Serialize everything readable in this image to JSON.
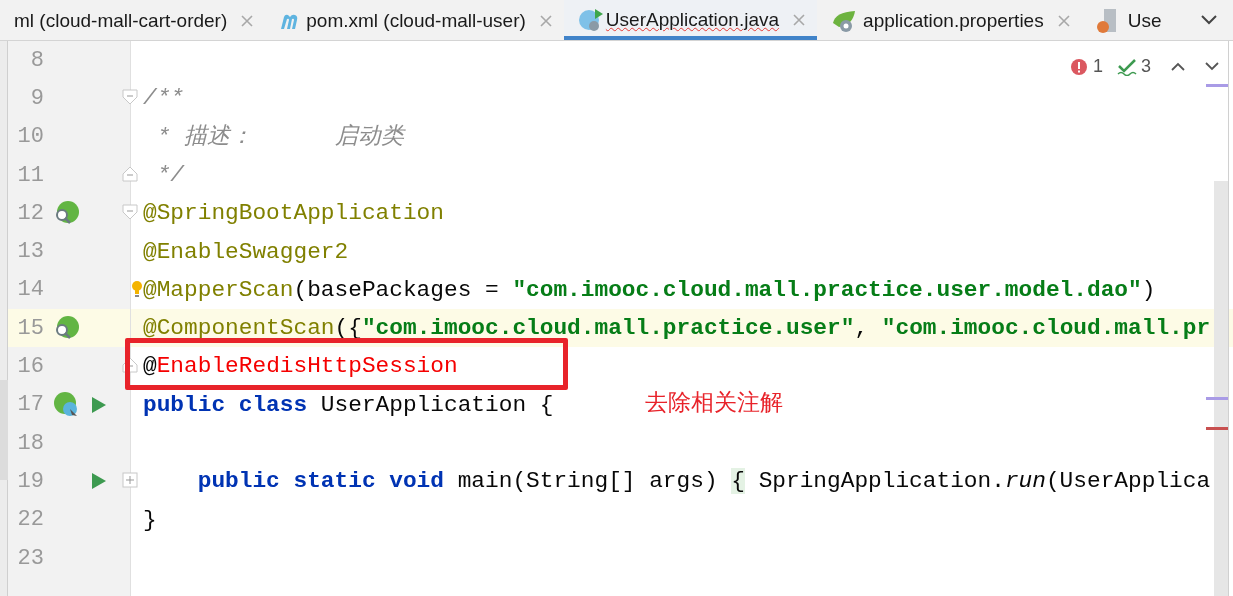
{
  "tabs": [
    {
      "label": "ml (cloud-mall-cart-order)",
      "selected": false
    },
    {
      "label": "pom.xml (cloud-mall-user)",
      "selected": false
    },
    {
      "label": "UserApplication.java",
      "selected": true
    },
    {
      "label": "application.properties",
      "selected": false
    },
    {
      "label": "Use",
      "selected": false
    }
  ],
  "inspections": {
    "errors": "1",
    "warnings": "3"
  },
  "lines": [
    {
      "number": "8"
    },
    {
      "number": "9",
      "fold": {
        "kind": "open"
      },
      "tokens": [
        {
          "text": "/**",
          "kind": "comment"
        }
      ]
    },
    {
      "number": "10",
      "tokens": [
        {
          "text": " * 描述：      启动类",
          "kind": "comment"
        }
      ]
    },
    {
      "number": "11",
      "fold": {
        "kind": "end"
      },
      "tokens": [
        {
          "text": " */",
          "kind": "comment"
        }
      ]
    },
    {
      "number": "12",
      "fold": {
        "kind": "open"
      },
      "markers": [
        {
          "kind": "bean"
        }
      ],
      "tokens": [
        {
          "text": "@SpringBootApplication",
          "kind": "annotation"
        }
      ]
    },
    {
      "number": "13",
      "tokens": [
        {
          "text": "@EnableSwagger2",
          "kind": "annotation"
        }
      ]
    },
    {
      "number": "14",
      "bulb": true,
      "tokens": [
        {
          "text": "@MapperScan",
          "kind": "annotation"
        },
        {
          "text": "(basePackages = ",
          "kind": "plain"
        },
        {
          "text": "\"com.imooc.cloud.mall.practice.user.model.dao\"",
          "kind": "string"
        },
        {
          "text": ")",
          "kind": "plain"
        }
      ]
    },
    {
      "number": "15",
      "current": true,
      "markers": [
        {
          "kind": "bean"
        }
      ],
      "tokens": [
        {
          "text": "@ComponentScan",
          "kind": "annotation"
        },
        {
          "text": "({",
          "kind": "plain"
        },
        {
          "text": "\"com.imooc.cloud.mall.practice.user\"",
          "kind": "string"
        },
        {
          "text": ", ",
          "kind": "plain"
        },
        {
          "text": "\"com.imooc.cloud.mall.pr",
          "kind": "string"
        }
      ]
    },
    {
      "number": "16",
      "fold": {
        "kind": "end"
      },
      "tokens": [
        {
          "text": "@",
          "kind": "plain"
        },
        {
          "text": "EnableRedisHttpSession",
          "kind": "error"
        }
      ]
    },
    {
      "number": "17",
      "markers": [
        {
          "kind": "bean-class"
        },
        {
          "kind": "run"
        }
      ],
      "tokens": [
        {
          "text": "public class ",
          "kind": "keyword"
        },
        {
          "text": "UserApplication {",
          "kind": "plain"
        }
      ]
    },
    {
      "number": "18"
    },
    {
      "number": "19",
      "fold": {
        "kind": "collapsed"
      },
      "markers": [
        {
          "kind": "spacer"
        },
        {
          "kind": "run"
        }
      ],
      "tokens": [
        {
          "text": "    public static void ",
          "kind": "keyword"
        },
        {
          "text": "main(String[] args) ",
          "kind": "plain"
        },
        {
          "text": "{",
          "kind": "folded"
        },
        {
          "text": " SpringApplication.",
          "kind": "plain"
        },
        {
          "text": "run",
          "kind": "italic"
        },
        {
          "text": "(UserApplica",
          "kind": "plain"
        }
      ]
    },
    {
      "number": "22",
      "tokens": [
        {
          "text": "}",
          "kind": "plain"
        }
      ]
    },
    {
      "number": "23"
    }
  ],
  "annotation": {
    "text": "去除相关注解"
  }
}
